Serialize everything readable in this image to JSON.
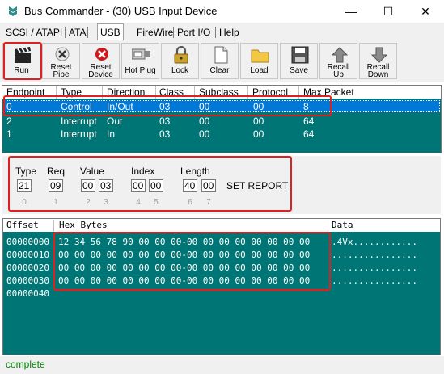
{
  "window": {
    "title": "Bus Commander - (30) USB Input Device",
    "min_symbol": "—",
    "max_symbol": "☐",
    "close_symbol": "✕"
  },
  "tabs": [
    "SCSI / ATAPI",
    "ATA",
    "USB",
    "FireWire",
    "Port I/O",
    "Help"
  ],
  "active_tab": "USB",
  "toolbar": {
    "run": "Run",
    "reset_pipe": [
      "Reset",
      "Pipe"
    ],
    "reset_device": [
      "Reset",
      "Device"
    ],
    "hot_plug": "Hot Plug",
    "lock": "Lock",
    "clear": "Clear",
    "load": "Load",
    "save": "Save",
    "recall_up": [
      "Recall",
      "Up"
    ],
    "recall_down": [
      "Recall",
      "Down"
    ]
  },
  "endpoints": {
    "headers": [
      "Endpoint",
      "Type",
      "Direction",
      "Class",
      "Subclass",
      "Protocol",
      "Max Packet"
    ],
    "rows": [
      [
        "0",
        "Control",
        "In/Out",
        "03",
        "00",
        "00",
        "8"
      ],
      [
        "2",
        "Interrupt",
        "Out",
        "03",
        "00",
        "00",
        "64"
      ],
      [
        "1",
        "Interrupt",
        "In",
        "03",
        "00",
        "00",
        "64"
      ]
    ],
    "selected_row": 0
  },
  "setup": {
    "type_label": "Type",
    "req_label": "Req",
    "value_label": "Value",
    "index_label": "Index",
    "length_label": "Length",
    "bytes": [
      "21",
      "09",
      "00",
      "03",
      "00",
      "00",
      "40",
      "00"
    ],
    "indices": [
      "0",
      "1",
      "2",
      "3",
      "4",
      "5",
      "6",
      "7"
    ],
    "request_name": "SET REPORT"
  },
  "hex": {
    "headers": {
      "offset": "Offset",
      "bytes": "Hex Bytes",
      "data": "Data"
    },
    "rows": [
      {
        "offset": "00000000",
        "bytes": "12 34 56 78 90 00 00 00-00 00 00 00 00 00 00 00",
        "data": ".4Vx............"
      },
      {
        "offset": "00000010",
        "bytes": "00 00 00 00 00 00 00 00-00 00 00 00 00 00 00 00",
        "data": "................"
      },
      {
        "offset": "00000020",
        "bytes": "00 00 00 00 00 00 00 00-00 00 00 00 00 00 00 00",
        "data": "................"
      },
      {
        "offset": "00000030",
        "bytes": "00 00 00 00 00 00 00 00-00 00 00 00 00 00 00 00",
        "data": "................"
      },
      {
        "offset": "00000040",
        "bytes": "",
        "data": ""
      }
    ]
  },
  "status": "complete",
  "colors": {
    "panel_teal": "#007575",
    "selection_blue": "#0078d7",
    "annotation_red": "#e02020",
    "status_green": "#008000"
  }
}
